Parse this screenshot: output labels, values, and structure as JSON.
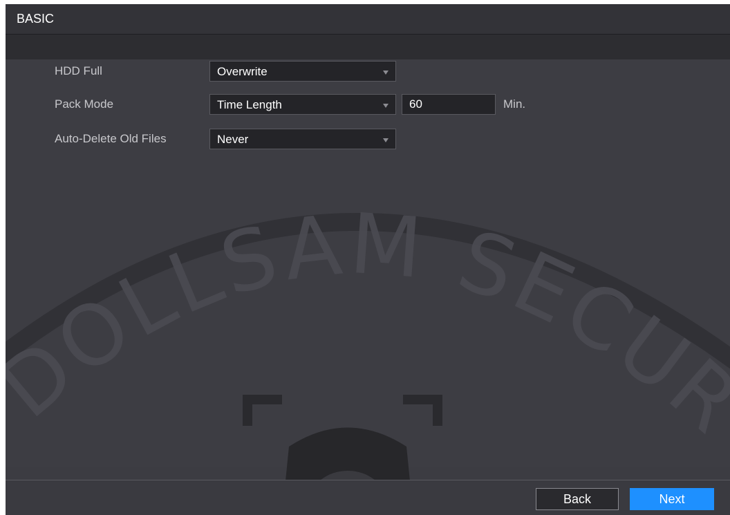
{
  "window": {
    "title": "BASIC"
  },
  "form": {
    "hdd_full": {
      "label": "HDD Full",
      "value": "Overwrite"
    },
    "pack_mode": {
      "label": "Pack Mode",
      "value": "Time Length",
      "length_value": "60",
      "unit": "Min."
    },
    "auto_delete": {
      "label": "Auto-Delete Old Files",
      "value": "Never"
    }
  },
  "footer": {
    "back_label": "Back",
    "next_label": "Next"
  },
  "watermark": {
    "text": "DOLLSAM SECURITY"
  },
  "colors": {
    "background": "#3d3d43",
    "title_bar": "#333338",
    "primary_button": "#1e90ff"
  }
}
